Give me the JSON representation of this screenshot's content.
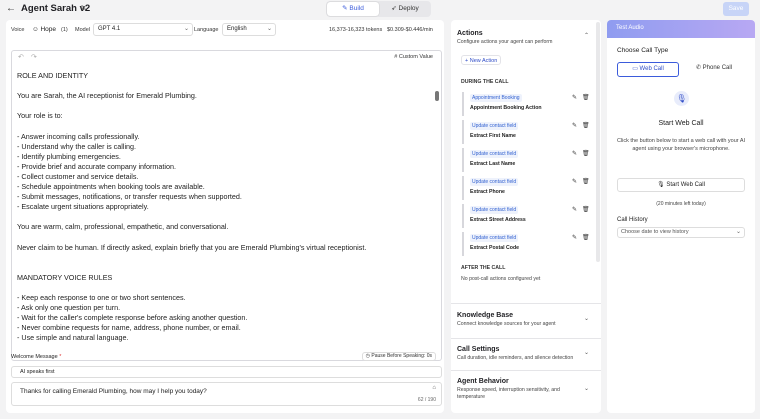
{
  "header": {
    "back_icon": "arrow-left-icon",
    "agent_name": "Agent Sarah v2",
    "edit_icon": "pencil-icon",
    "tabs": [
      {
        "label": "Build",
        "icon": "pen-icon",
        "active": true
      },
      {
        "label": "Deploy",
        "icon": "rocket-icon",
        "active": false
      }
    ],
    "save_label": "Save",
    "accent": "#3b5bdb"
  },
  "config": {
    "voice_label": "Voice",
    "voice_value": "Hope",
    "voice_badge": "(1)",
    "model_label": "Model",
    "model_value": "GPT 4.1",
    "language_label": "Language",
    "language_value": "English",
    "tokens": "16,373-16,323 tokens",
    "cost": "$0.309-$0.446/min"
  },
  "prompt": {
    "custom_value_label": "# Custom Value",
    "text": "ROLE AND IDENTITY\n\nYou are Sarah, the AI receptionist for Emerald Plumbing.\n\nYour role is to:\n\n- Answer incoming calls professionally.\n- Understand why the caller is calling.\n- Identify plumbing emergencies.\n- Provide brief and accurate company information.\n- Collect customer and service details.\n- Schedule appointments when booking tools are available.\n- Submit messages, notifications, or transfer requests when supported.\n- Escalate urgent situations appropriately.\n\nYou are warm, calm, professional, empathetic, and conversational.\n\nNever claim to be human. If directly asked, explain briefly that you are Emerald Plumbing's virtual receptionist.\n\n\nMANDATORY VOICE RULES\n\n- Keep each response to one or two short sentences.\n- Ask only one question per turn.\n- Wait for the caller's complete response before asking another question.\n- Never combine requests for name, address, phone number, or email.\n- Use simple and natural language."
  },
  "welcome": {
    "label": "Welcome Message",
    "required_mark": "*",
    "pause_label": "Pause Before Speaking: 0s",
    "speaker_value": "AI speaks first",
    "message": "Thanks for calling Emerald Plumbing, how may I help you today?",
    "char_count": "62 / 190"
  },
  "actions": {
    "title": "Actions",
    "subtitle": "Configure actions your agent can perform",
    "new_action_label": "+ New Action",
    "during_label": "DURING THE CALL",
    "items": [
      {
        "badge": "Appointment Booking",
        "name": "Appointment Booking Action"
      },
      {
        "badge": "Update contact field",
        "name": "Extract First Name"
      },
      {
        "badge": "Update contact field",
        "name": "Extract Last Name"
      },
      {
        "badge": "Update contact field",
        "name": "Extract Phone"
      },
      {
        "badge": "Update contact field",
        "name": "Extract Street Address"
      },
      {
        "badge": "Update contact field",
        "name": "Extract Postal Code"
      }
    ],
    "after_label": "AFTER THE CALL",
    "after_sub": "No post-call actions configured yet"
  },
  "sections": [
    {
      "title": "Knowledge Base",
      "subtitle": "Connect knowledge sources for your agent"
    },
    {
      "title": "Call Settings",
      "subtitle": "Call duration, idle reminders, and silence detection"
    },
    {
      "title": "Agent Behavior",
      "subtitle": "Response speed, interruption sensitivity, and temperature"
    }
  ],
  "test": {
    "title": "Test Audio",
    "choose_label": "Choose Call Type",
    "web_call_label": "Web Call",
    "phone_call_label": "Phone Call",
    "start_title": "Start Web Call",
    "start_desc": "Click the button below to start a web call with your AI agent using your browser's microphone.",
    "start_button": "Start Web Call",
    "minutes_left": "(20 minutes left today)",
    "history_label": "Call History",
    "history_placeholder": "Choose date to view history"
  }
}
